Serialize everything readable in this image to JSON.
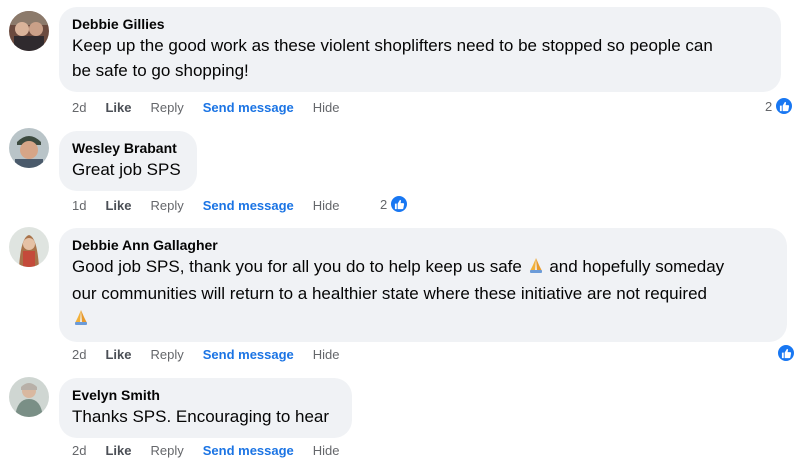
{
  "comments": [
    {
      "author": "Debbie Gillies",
      "line1": "Keep up the good work as these violent shoplifters need to be stopped so people can",
      "line2": "be safe to go shopping!",
      "time": "2d",
      "like": "Like",
      "reply": "Reply",
      "send": "Send message",
      "hide": "Hide",
      "reactions": "2"
    },
    {
      "author": "Wesley Brabant",
      "line1": "Great job SPS",
      "time": "1d",
      "like": "Like",
      "reply": "Reply",
      "send": "Send message",
      "hide": "Hide",
      "reactions": "2"
    },
    {
      "author": "Debbie Ann Gallagher",
      "line1_a": "Good job SPS, thank you for all you do to help keep us safe",
      "line1_b": "and hopefully someday",
      "line2": "our communities will return to a healthier state where these initiative are not required",
      "time": "2d",
      "like": "Like",
      "reply": "Reply",
      "send": "Send message",
      "hide": "Hide"
    },
    {
      "author": "Evelyn Smith",
      "line1": "Thanks SPS. Encouraging to hear",
      "time": "2d",
      "like": "Like",
      "reply": "Reply",
      "send": "Send message",
      "hide": "Hide"
    }
  ],
  "icons": {
    "reaction": "like-icon",
    "emoji": "folded-hands-icon"
  },
  "colors": {
    "bubble": "#f0f2f5",
    "link": "#1b74e4",
    "like_badge": "#1877f2"
  }
}
